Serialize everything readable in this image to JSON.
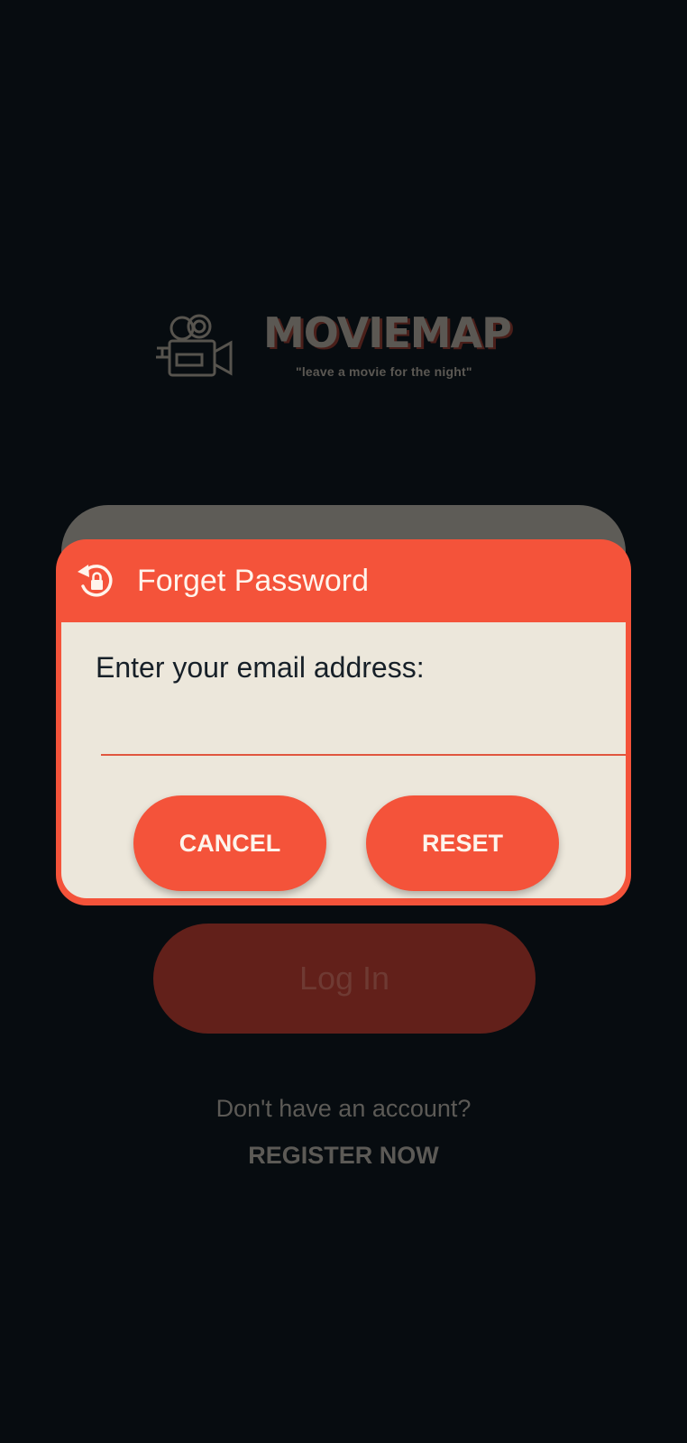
{
  "app": {
    "brand": "MOVIEMAP",
    "tagline": "\"leave a movie for the night\"",
    "logo_icon": "movie-camera-icon"
  },
  "login": {
    "login_label": "Log In",
    "no_account_text": "Don't have an account?",
    "register_label": "REGISTER NOW"
  },
  "dialog": {
    "title": "Forget Password",
    "title_icon": "lock-reset-icon",
    "prompt": "Enter your email address:",
    "email_value": "",
    "cancel_label": "CANCEL",
    "reset_label": "RESET"
  },
  "colors": {
    "accent": "#f4533a",
    "background": "#070c10",
    "dialog_body": "#ece7db"
  }
}
